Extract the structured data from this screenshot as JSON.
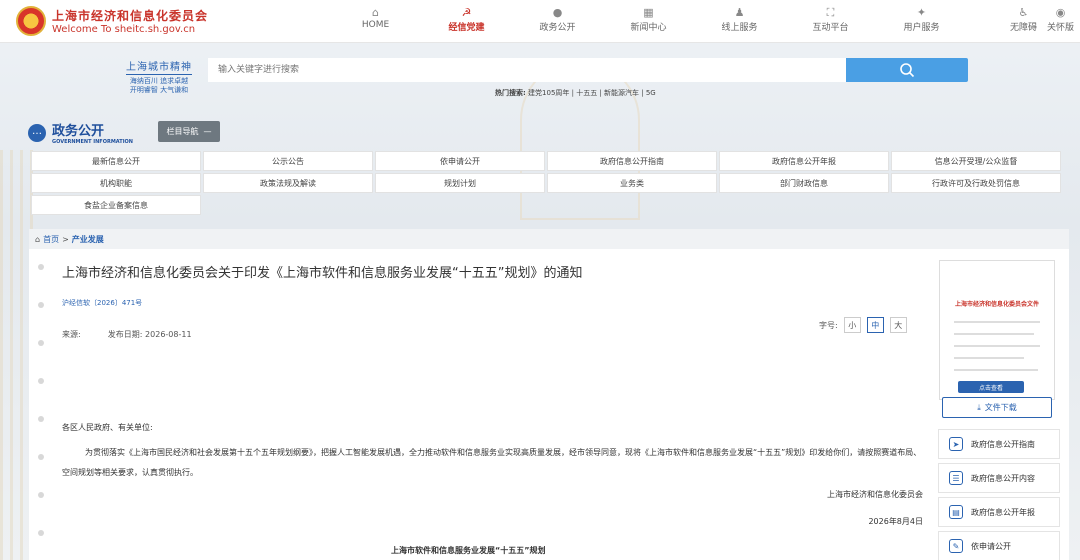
{
  "header": {
    "logo_cn": "上海市经济和信息化委员会",
    "logo_en": "Welcome To sheitc.sh.gov.cn",
    "nav": [
      {
        "label": "HOME",
        "icon": "home-icon",
        "glyph": "⌂"
      },
      {
        "label": "经信党建",
        "icon": "party-icon",
        "glyph": "☭"
      },
      {
        "label": "政务公开",
        "icon": "chat-icon",
        "glyph": "●"
      },
      {
        "label": "新闻中心",
        "icon": "news-icon",
        "glyph": "▦"
      },
      {
        "label": "线上服务",
        "icon": "person-service-icon",
        "glyph": "♟"
      },
      {
        "label": "互动平台",
        "icon": "interact-icon",
        "glyph": "⛶"
      },
      {
        "label": "用户服务",
        "icon": "user-service-icon",
        "glyph": "✦"
      }
    ],
    "active_nav": "经信党建",
    "util": [
      {
        "label": "无障碍",
        "icon": "accessibility-icon",
        "glyph": "♿"
      },
      {
        "label": "关怀版",
        "icon": "care-icon",
        "glyph": "◉"
      }
    ]
  },
  "search": {
    "slogan_title": "上海城市精神",
    "slogan_line1": "海纳百川 追求卓越",
    "slogan_line2": "开明睿智 大气谦和",
    "placeholder": "输入关键字进行搜索",
    "hot_label": "热门搜索:",
    "hot_terms": "建党105周年 | 十五五 | 新能源汽车 | 5G"
  },
  "section": {
    "title_cn": "政务公开",
    "title_en": "GOVERNMENT INFORMATION",
    "menu_button": "栏目导航"
  },
  "grid": [
    "最新信息公开",
    "公示公告",
    "依申请公开",
    "政府信息公开指南",
    "政府信息公开年报",
    "信息公开受理/公众监督",
    "机构职能",
    "政策法规及解读",
    "规划计划",
    "业务类",
    "部门财政信息",
    "行政许可及行政处罚信息",
    "食盐企业备案信息"
  ],
  "breadcrumb": {
    "home": "首页",
    "sep": ">",
    "current": "产业发展"
  },
  "article": {
    "title": "上海市经济和信息化委员会关于印发《上海市软件和信息服务业发展“十五五”规划》的通知",
    "doc_no": "沪经信软〔2026〕471号",
    "source_label": "来源:",
    "date_label": "发布日期:",
    "date": "2026-08-11",
    "fontsize_label": "字号:",
    "fontsizes": [
      "小",
      "中",
      "大"
    ],
    "salutation": "各区人民政府、有关单位:",
    "paragraph": "为贯彻落实《上海市国民经济和社会发展第十五个五年规划纲要》，把握人工智能发展机遇，全力推动软件和信息服务业实现高质量发展，经市领导同意，现将《上海市软件和信息服务业发展“十五五”规划》印发给你们，请按照赛道布局、空间规划等相关要求，认真贯彻执行。",
    "signer": "上海市经济和信息化委员会",
    "sign_date": "2026年8月4日",
    "subtitle": "上海市软件和信息服务业发展“十五五”规划"
  },
  "side": {
    "thumb_title": "上海市经济和信息化委员会文件",
    "thumb_button": "点击查看",
    "download": "文件下载",
    "links": [
      {
        "label": "政府信息公开指南",
        "icon": "compass-icon",
        "glyph": "➤"
      },
      {
        "label": "政府信息公开内容",
        "icon": "list-icon",
        "glyph": "☰"
      },
      {
        "label": "政府信息公开年报",
        "icon": "report-icon",
        "glyph": "▤"
      },
      {
        "label": "依申请公开",
        "icon": "apply-icon",
        "glyph": "✎"
      }
    ]
  }
}
